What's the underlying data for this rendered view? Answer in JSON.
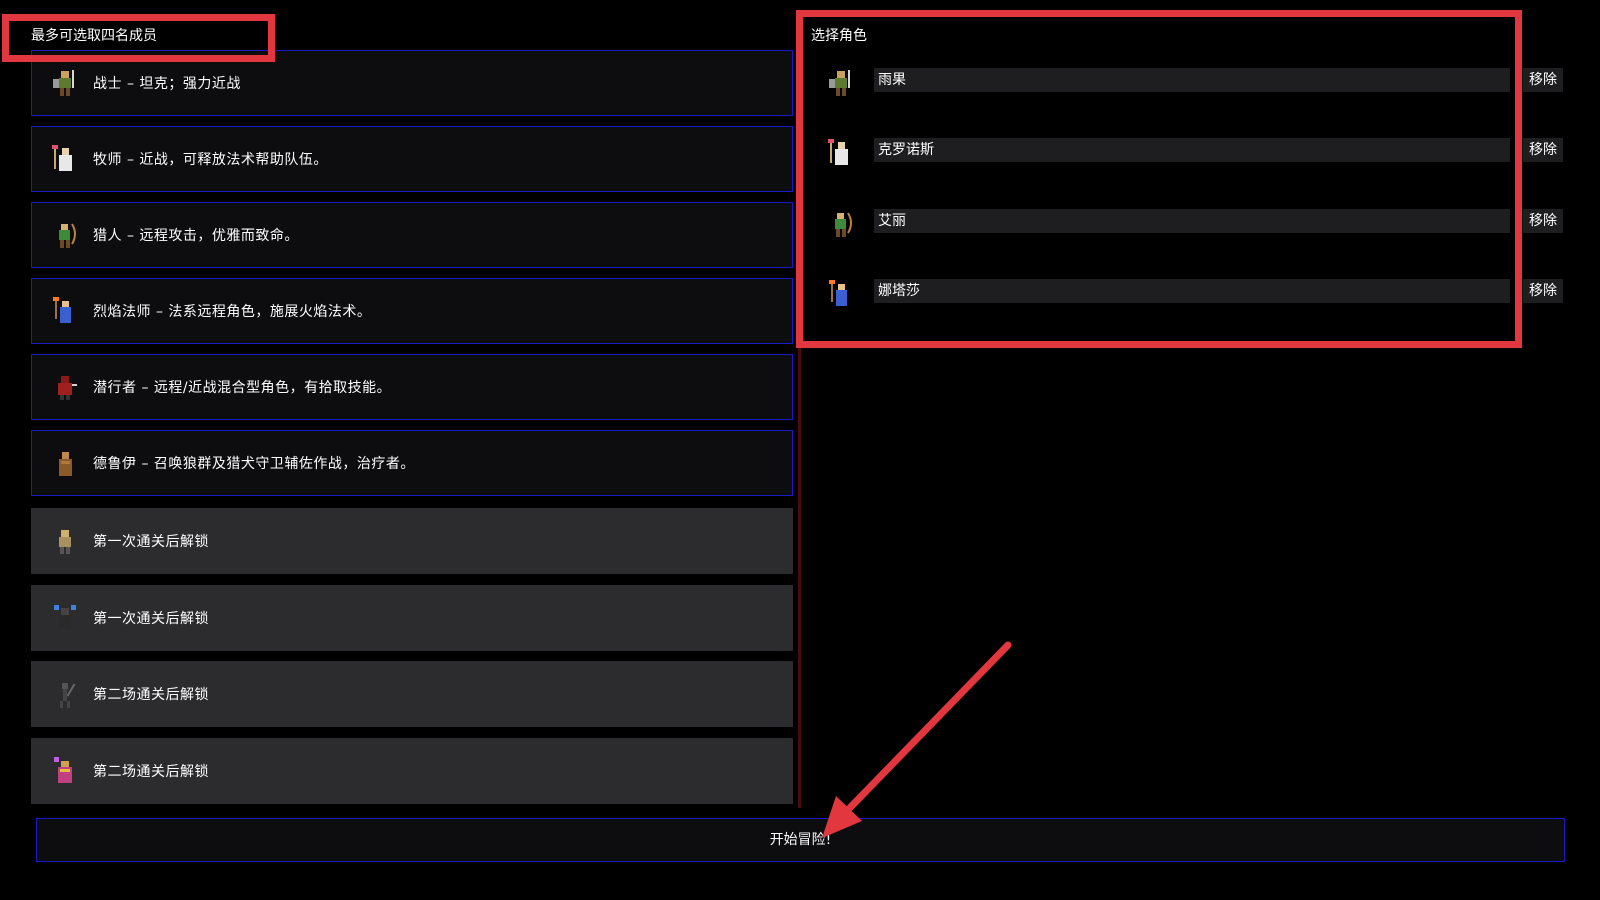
{
  "left_panel": {
    "header": "最多可选取四名成员",
    "classes": [
      {
        "text": "战士 – 坦克；强力近战",
        "icon": "warrior-sprite-icon",
        "locked": false
      },
      {
        "text": "牧师 – 近战，可释放法术帮助队伍。",
        "icon": "priest-sprite-icon",
        "locked": false
      },
      {
        "text": "猎人 – 远程攻击，优雅而致命。",
        "icon": "hunter-sprite-icon",
        "locked": false
      },
      {
        "text": "烈焰法师 – 法系远程角色，施展火焰法术。",
        "icon": "fire-mage-sprite-icon",
        "locked": false
      },
      {
        "text": "潜行者 – 远程/近战混合型角色，有拾取技能。",
        "icon": "rogue-sprite-icon",
        "locked": false
      },
      {
        "text": "德鲁伊 – 召唤狼群及猎犬守卫辅佐作战，治疗者。",
        "icon": "druid-sprite-icon",
        "locked": false
      },
      {
        "text": "第一次通关后解锁",
        "icon": "locked-monk-sprite-icon",
        "locked": true
      },
      {
        "text": "第一次通关后解锁",
        "icon": "locked-caster-sprite-icon",
        "locked": true
      },
      {
        "text": "第二场通关后解锁",
        "icon": "locked-skeleton-sprite-icon",
        "locked": true
      },
      {
        "text": "第二场通关后解锁",
        "icon": "locked-shaman-sprite-icon",
        "locked": true
      }
    ]
  },
  "right_panel": {
    "title": "选择角色",
    "remove_label": "移除",
    "party": [
      {
        "name": "雨果",
        "icon": "warrior-sprite-icon"
      },
      {
        "name": "克罗诺斯",
        "icon": "priest-sprite-icon"
      },
      {
        "name": "艾丽",
        "icon": "hunter-sprite-icon"
      },
      {
        "name": "娜塔莎",
        "icon": "fire-mage-sprite-icon"
      }
    ]
  },
  "start_button": "开始冒险!",
  "colors": {
    "background": "#000000",
    "item_border": "#1b1bc6",
    "locked_bg": "#2c2c2e",
    "annotation": "#e2373f"
  }
}
